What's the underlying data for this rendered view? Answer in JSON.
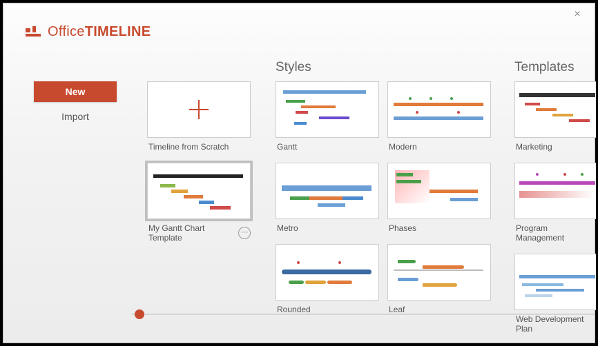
{
  "brand": {
    "light": "Office",
    "bold": "TIMELINE"
  },
  "sidebar": {
    "new": "New",
    "import": "Import"
  },
  "sections": {
    "styles": "Styles",
    "templates": "Templates"
  },
  "local": {
    "scratch": "Timeline from Scratch",
    "mygantt": "My Gantt Chart Template"
  },
  "styles": {
    "gantt": "Gantt",
    "modern": "Modern",
    "metro": "Metro",
    "phases": "Phases",
    "rounded": "Rounded",
    "leaf": "Leaf"
  },
  "templates": {
    "marketing": "Marketing",
    "program": "Program Management",
    "webdev": "Web Development Plan"
  },
  "colors": {
    "accent": "#c84a2e"
  }
}
